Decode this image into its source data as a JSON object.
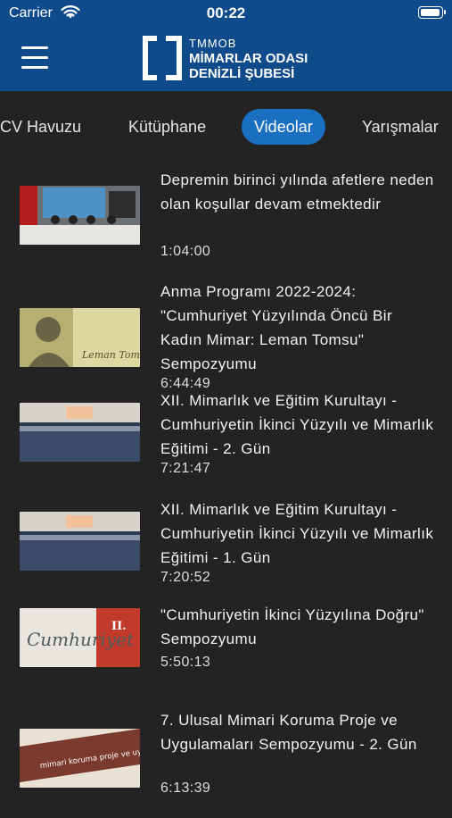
{
  "status": {
    "carrier": "Carrier",
    "time": "00:22",
    "battery_level": 0.95
  },
  "header": {
    "logo_line1": "TMMOB",
    "logo_line2": "MİMARLAR ODASI",
    "logo_line3": "DENİZLİ ŞUBESİ",
    "brand_color": "#0f4a8a"
  },
  "tabs": [
    {
      "label": "CV Havuzu"
    },
    {
      "label": "Kütüphane"
    },
    {
      "label": "Videolar",
      "active": true
    },
    {
      "label": "Yarışmalar"
    }
  ],
  "videos": [
    {
      "title": "Depremin birinci yılında afetlere neden olan koşullar devam etmektedir",
      "duration": "1:04:00"
    },
    {
      "title": "Anma Programı 2022-2024: \"Cumhuriyet Yüzyılında Öncü Bir Kadın Mimar: Leman Tomsu\" Sempozyumu",
      "duration": "6:44:49",
      "thumb_caption": "Leman Tomsu"
    },
    {
      "title": "XII. Mimarlık ve Eğitim Kurultayı - Cumhuriyetin İkinci Yüzyılı ve Mimarlık Eğitimi - 2. Gün",
      "duration": "7:21:47"
    },
    {
      "title": "XII. Mimarlık ve Eğitim Kurultayı - Cumhuriyetin İkinci Yüzyılı ve Mimarlık Eğitimi - 1. Gün",
      "duration": "7:20:52"
    },
    {
      "title": "\"Cumhuriyetin İkinci Yüzyılına Doğru\" Sempozyumu",
      "duration": "5:50:13",
      "thumb_caption": "Cumhuriyet",
      "thumb_badge": "II."
    },
    {
      "title": "7. Ulusal Mimari Koruma Proje ve Uygulamaları Sempozyumu - 2. Gün",
      "duration": "6:13:39",
      "thumb_caption": "mimari koruma proje ve uygulamaları"
    }
  ]
}
